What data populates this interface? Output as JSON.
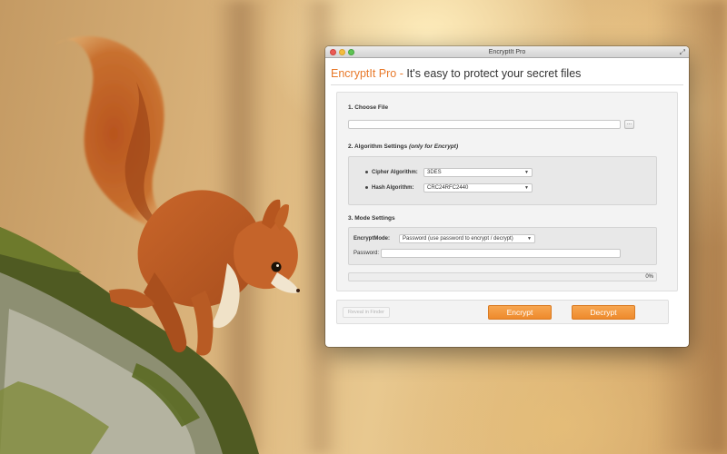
{
  "window": {
    "title": "EncryptIt Pro"
  },
  "header": {
    "brand": "EncryptIt Pro",
    "separator": " - ",
    "tagline": "It's easy to protect your secret files"
  },
  "sections": {
    "choose_file": {
      "title": "1. Choose File",
      "file_value": "",
      "browse_label": "..."
    },
    "algorithm": {
      "title": "2. Algorithm Settings",
      "note": "(only for Encrypt)",
      "cipher_label": "Cipher Algorithm:",
      "cipher_value": "3DES",
      "hash_label": "Hash Algorithm:",
      "hash_value": "CRC24RFC2440"
    },
    "mode": {
      "title": "3. Mode Settings",
      "mode_label": "EncryptMode:",
      "mode_value": "Password (use password to encrypt / decrypt)",
      "password_label": "Password:",
      "password_value": ""
    }
  },
  "progress": {
    "value": 0,
    "label": "0%"
  },
  "actions": {
    "reveal_label": "Reveal in Finder",
    "encrypt_label": "Encrypt",
    "decrypt_label": "Decrypt"
  },
  "icons": {
    "fullscreen": "fullscreen-icon",
    "dropdown": "chevron-down-icon"
  },
  "colors": {
    "accent": "#e8792a",
    "button": "#f29a3e"
  }
}
